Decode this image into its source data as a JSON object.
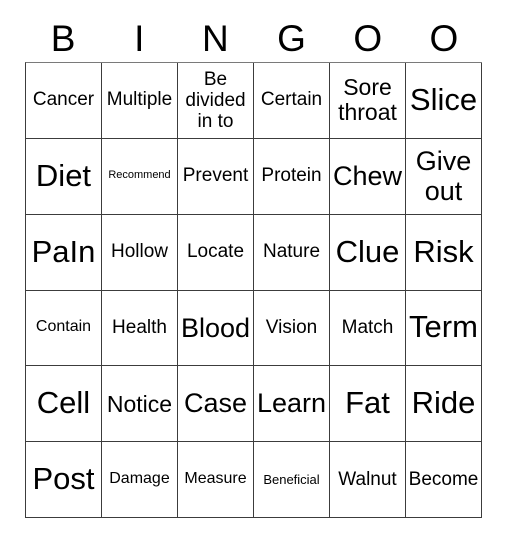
{
  "card": {
    "title": "Bingo Card",
    "columns": 6,
    "rows": 6,
    "header_letters": [
      "B",
      "I",
      "N",
      "G",
      "O",
      "O"
    ],
    "colors": {
      "background": "#ffffff",
      "text": "#000000",
      "grid_line": "#3c3c3c",
      "grid_line_top": "#7a7a7a"
    },
    "grid": [
      [
        {
          "text": "Cancer",
          "size": "md"
        },
        {
          "text": "Multiple",
          "size": "md"
        },
        {
          "text": "Be divided in to",
          "size": "md",
          "wrapped": true
        },
        {
          "text": "Certain",
          "size": "md"
        },
        {
          "text": "Sore throat",
          "size": "lg",
          "wrapped": true
        },
        {
          "text": "Slice",
          "size": "xxl"
        }
      ],
      [
        {
          "text": "Diet",
          "size": "xxl"
        },
        {
          "text": "Recommend",
          "size": "xxs"
        },
        {
          "text": "Prevent",
          "size": "md"
        },
        {
          "text": "Protein",
          "size": "md"
        },
        {
          "text": "Chew",
          "size": "xl"
        },
        {
          "text": "Give out",
          "size": "xl",
          "wrapped": true
        }
      ],
      [
        {
          "text": "PaIn",
          "size": "xxl"
        },
        {
          "text": "Hollow",
          "size": "md"
        },
        {
          "text": "Locate",
          "size": "md"
        },
        {
          "text": "Nature",
          "size": "md"
        },
        {
          "text": "Clue",
          "size": "xxl"
        },
        {
          "text": "Risk",
          "size": "xxl"
        }
      ],
      [
        {
          "text": "Contain",
          "size": "sm"
        },
        {
          "text": "Health",
          "size": "md"
        },
        {
          "text": "Blood",
          "size": "xl"
        },
        {
          "text": "Vision",
          "size": "md"
        },
        {
          "text": "Match",
          "size": "md"
        },
        {
          "text": "Term",
          "size": "xxl"
        }
      ],
      [
        {
          "text": "Cell",
          "size": "xxl"
        },
        {
          "text": "Notice",
          "size": "lg"
        },
        {
          "text": "Case",
          "size": "xl"
        },
        {
          "text": "Learn",
          "size": "xl"
        },
        {
          "text": "Fat",
          "size": "xxl"
        },
        {
          "text": "Ride",
          "size": "xxl"
        }
      ],
      [
        {
          "text": "Post",
          "size": "xxl"
        },
        {
          "text": "Damage",
          "size": "sm"
        },
        {
          "text": "Measure",
          "size": "sm"
        },
        {
          "text": "Beneficial",
          "size": "xs"
        },
        {
          "text": "Walnut",
          "size": "md"
        },
        {
          "text": "Become",
          "size": "md"
        }
      ]
    ]
  }
}
